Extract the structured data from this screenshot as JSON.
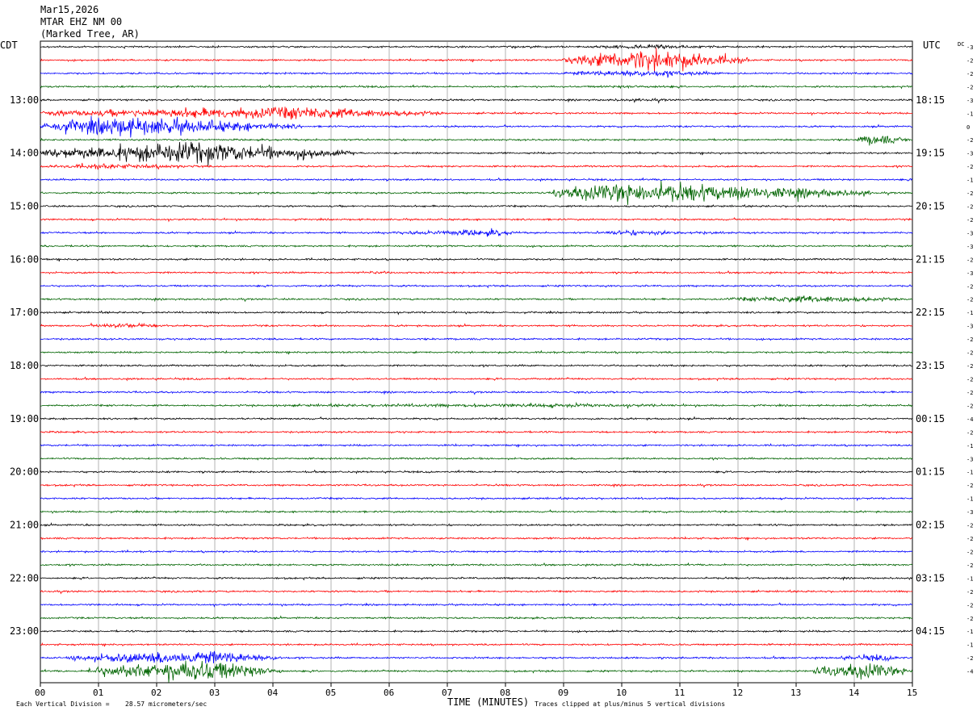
{
  "header": {
    "date": "Mar15,2026",
    "station": "MTAR EHZ NM 00",
    "location": "(Marked Tree, AR)"
  },
  "left_axis_title": "CDT",
  "right_axis_title": "UTC",
  "dc_label": "DC",
  "footer": {
    "scale_prefix": "Each Vertical Division =",
    "scale_value": "28.57 micrometers/sec",
    "time_label": "TIME (MINUTES)",
    "clip_note": "Traces clipped at plus/minus 5 vertical divisions"
  },
  "colors": {
    "black": "#000000",
    "red": "#ff0000",
    "blue": "#0000ff",
    "green": "#006400",
    "grid": "#808080"
  },
  "chart_data": {
    "type": "line",
    "title": "",
    "xlabel": "TIME (MINUTES)",
    "ylabel": "",
    "x_ticks": [
      "00",
      "01",
      "02",
      "03",
      "04",
      "05",
      "06",
      "07",
      "08",
      "09",
      "10",
      "11",
      "12",
      "13",
      "14",
      "15"
    ],
    "xlim": [
      0,
      15
    ],
    "n_traces": 48,
    "trace_minutes": 15,
    "trace_colors": [
      "black",
      "red",
      "blue",
      "green"
    ],
    "left_hour_labels": [
      "13:00",
      "14:00",
      "15:00",
      "16:00",
      "17:00",
      "18:00",
      "19:00",
      "20:00",
      "21:00",
      "22:00",
      "23:00"
    ],
    "right_hour_labels": [
      "18:15",
      "19:15",
      "20:15",
      "21:15",
      "22:15",
      "23:15",
      "00:15",
      "01:15",
      "02:15",
      "03:15",
      "04:15"
    ],
    "first_labeled_trace": 4,
    "dc_offsets": [
      "-3",
      "-2",
      "-2",
      "-2",
      "-3",
      "-1",
      "0",
      "-2",
      "-3",
      "-2",
      "-1",
      "-2",
      "-2",
      "-2",
      "-3",
      "-3",
      "-2",
      "-3",
      "-2",
      "-2",
      "-1",
      "-3",
      "-2",
      "-2",
      "-2",
      "-2",
      "-2",
      "-2",
      "-4",
      "-2",
      "-1",
      "-3",
      "-1",
      "-2",
      "-1",
      "-3",
      "-2",
      "-2",
      "-2",
      "-2",
      "-1",
      "-2",
      "-2",
      "-2",
      "-1",
      "-1",
      "-2",
      "-4"
    ],
    "noise_level_divisions": 0.4,
    "clip_divisions": 5,
    "events": [
      {
        "trace": 1,
        "start_min": 9.0,
        "end_min": 12.2,
        "peak_min": 10.5,
        "amplitude": 5.0
      },
      {
        "trace": 0,
        "start_min": 9.3,
        "end_min": 11.8,
        "peak_min": 10.5,
        "amplitude": 1.2
      },
      {
        "trace": 2,
        "start_min": 8.8,
        "end_min": 12.0,
        "peak_min": 10.3,
        "amplitude": 1.6
      },
      {
        "trace": 3,
        "start_min": 9.2,
        "end_min": 11.5,
        "peak_min": 10.3,
        "amplitude": 0.8
      },
      {
        "trace": 4,
        "start_min": 9.2,
        "end_min": 11.5,
        "peak_min": 10.3,
        "amplitude": 0.7
      },
      {
        "trace": 5,
        "start_min": 0.0,
        "end_min": 7.0,
        "peak_min": 4.5,
        "amplitude": 3.0
      },
      {
        "trace": 6,
        "start_min": 0.0,
        "end_min": 4.5,
        "peak_min": 1.3,
        "amplitude": 4.5
      },
      {
        "trace": 7,
        "start_min": 14.0,
        "end_min": 15.0,
        "peak_min": 14.3,
        "amplitude": 2.6
      },
      {
        "trace": 8,
        "start_min": 0.0,
        "end_min": 5.4,
        "peak_min": 2.5,
        "amplitude": 5.0
      },
      {
        "trace": 9,
        "start_min": 0.0,
        "end_min": 3.5,
        "peak_min": 1.0,
        "amplitude": 1.2
      },
      {
        "trace": 11,
        "start_min": 8.8,
        "end_min": 14.3,
        "peak_min": 10.0,
        "amplitude": 5.0
      },
      {
        "trace": 14,
        "start_min": 5.8,
        "end_min": 8.3,
        "peak_min": 7.8,
        "amplitude": 1.5
      },
      {
        "trace": 14,
        "start_min": 9.5,
        "end_min": 12.5,
        "peak_min": 10.0,
        "amplitude": 1.2
      },
      {
        "trace": 17,
        "start_min": 5.3,
        "end_min": 6.4,
        "peak_min": 5.7,
        "amplitude": 0.8
      },
      {
        "trace": 19,
        "start_min": 11.8,
        "end_min": 15.0,
        "peak_min": 13.3,
        "amplitude": 1.8
      },
      {
        "trace": 21,
        "start_min": 0.8,
        "end_min": 2.5,
        "peak_min": 1.4,
        "amplitude": 1.3
      },
      {
        "trace": 27,
        "start_min": 2.3,
        "end_min": 12.5,
        "peak_min": 9.0,
        "amplitude": 0.9
      },
      {
        "trace": 46,
        "start_min": 0.5,
        "end_min": 4.2,
        "peak_min": 2.8,
        "amplitude": 3.5
      },
      {
        "trace": 47,
        "start_min": 0.8,
        "end_min": 4.2,
        "peak_min": 2.8,
        "amplitude": 5.0
      },
      {
        "trace": 47,
        "start_min": 13.3,
        "end_min": 15.0,
        "peak_min": 14.3,
        "amplitude": 4.0
      },
      {
        "trace": 46,
        "start_min": 13.6,
        "end_min": 15.0,
        "peak_min": 14.4,
        "amplitude": 1.5
      }
    ]
  }
}
